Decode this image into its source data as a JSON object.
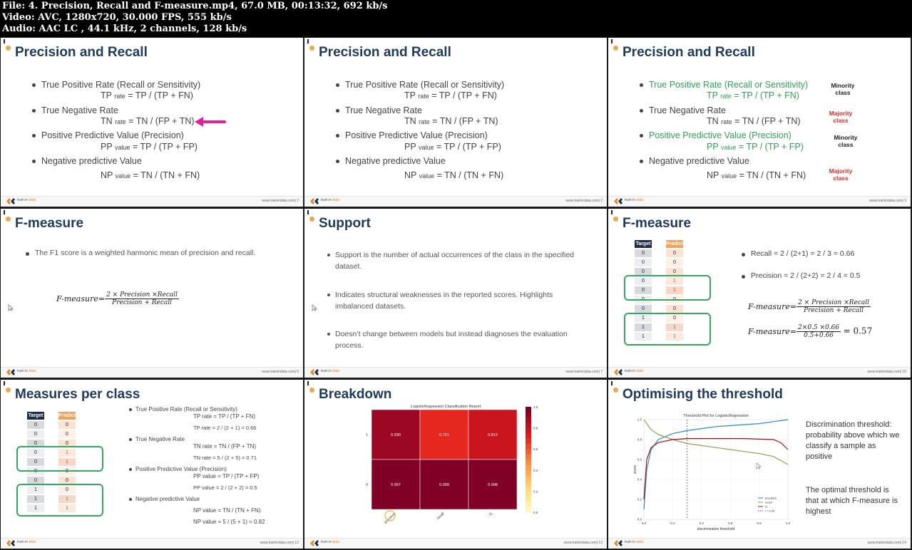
{
  "media_info": {
    "file": "File: 4. Precision, Recall and F-measure.mp4, 67.0 MB, 00:13:32, 692 kb/s",
    "video": "Video: AVC, 1280x720, 30.000 FPS, 555 kb/s",
    "audio": "Audio: AAC LC , 44.1 kHz, 2 channels, 128 kb/s"
  },
  "logo": {
    "brand_a": "train in",
    "brand_b": "data"
  },
  "slides": {
    "s1": {
      "title": "Precision and Recall",
      "b1": "True Positive Rate (Recall or Sensitivity)",
      "f1_pre": "TP",
      "f1_sub": "rate",
      "f1_post": "=   TP /  (TP + FN)",
      "b2": "True Negative Rate",
      "f2_pre": "TN",
      "f2_sub": "rate",
      "f2_post": "=  TN /  (FP + TN)",
      "b3": "Positive Predictive Value (Precision)",
      "f3_pre": "PP",
      "f3_sub": "value",
      "f3_post": "=  TP /  (TP + FP)",
      "b4": "Negative predictive Value",
      "f4_pre": "NP",
      "f4_sub": "value",
      "f4_post": "=  TN /  (TN + FN)",
      "url": "www.trainindata.com| 2"
    },
    "s2": {
      "title": "Precision and Recall",
      "b1": "True Positive Rate (Recall or Sensitivity)",
      "f1_pre": "TP",
      "f1_sub": "rate",
      "f1_post": "=   TP /  (TP + FN)",
      "b2": "True Negative Rate",
      "f2_pre": "TN",
      "f2_sub": "rate",
      "f2_post": "=  TN /  (FP + TN)",
      "b3": "Positive Predictive Value (Precision)",
      "f3_pre": "PP",
      "f3_sub": "value",
      "f3_post": "=  TP /  (TP + FP)",
      "b4": "Negative predictive Value",
      "f4_pre": "NP",
      "f4_sub": "value",
      "f4_post": "=  TN /  (TN + FN)",
      "url": "www.trainindata.com| 2"
    },
    "s3": {
      "title": "Precision and Recall",
      "b1": "True Positive Rate (Recall or Sensitivity)",
      "f1_pre": "TP",
      "f1_sub": "rate",
      "f1_post": "=   TP /  (TP + FN)",
      "b2": "True Negative Rate",
      "f2_pre": "TN",
      "f2_sub": "rate",
      "f2_post": "=  TN /  (FP + TN)",
      "b3": "Positive Predictive Value (Precision)",
      "f3_pre": "PP",
      "f3_sub": "value",
      "f3_post": "=  TP /  (TP + FP)",
      "b4": "Negative predictive Value",
      "f4_pre": "NP",
      "f4_sub": "value",
      "f4_post": "=  TN /  (TN + FN)",
      "side1": "Minority class",
      "side2": "Majority class",
      "side3": "Minority class",
      "side4": "Majority class",
      "url": "www.trainindata.com| 3"
    },
    "s4": {
      "title": "F-measure",
      "b1": "The F1 score is a weighted harmonic mean of precision and recall.",
      "lhs": "F-measure=",
      "num": "2 × Precision ×Recall",
      "den": "Precision + Recall",
      "url": "www.trainindata.com| 5"
    },
    "s5": {
      "title": "Support",
      "b1": "Support is the number of actual occurrences of the class in the specified dataset.",
      "b2": "Indicates structural weaknesses in the reported scores. Highlights imbalanced datasets.",
      "b3": "Doesn’t change between models but instead diagnoses the evaluation process.",
      "url": "www.trainindata.com| 7"
    },
    "s6": {
      "title": "F-measure",
      "head_target": "Target",
      "head_pred": "Prediction",
      "targets": [
        "0",
        "0",
        "0",
        "0",
        "0",
        "0",
        "0",
        "1",
        "1",
        "1"
      ],
      "preds": [
        "0",
        "0",
        "0",
        "1",
        "1",
        "0",
        "0",
        "0",
        "1",
        "1"
      ],
      "recall": "Recall = 2 / (2+1) = 2 / 3 = 0.66",
      "precision": "Precision = 2 / (2+2) = 2 / 4 = 0.5",
      "lhs1": "F-measure=",
      "num1": "2 × Precision ×Recall",
      "den1": "Precision + Recall",
      "lhs2": "F-measure=",
      "num2": "2×0.5 ×0.66",
      "den2": "0.5+0.66",
      "result": "= 0.57",
      "url": "www.trainindata.com| 10"
    },
    "s7": {
      "title": "Measures per class",
      "head_target": "Target",
      "head_pred": "Prediction",
      "targets": [
        "0",
        "0",
        "0",
        "0",
        "0",
        "0",
        "0",
        "1",
        "1",
        "1"
      ],
      "preds": [
        "0",
        "0",
        "0",
        "1",
        "1",
        "0",
        "0",
        "0",
        "1",
        "1"
      ],
      "b1": "True Positive Rate (Recall or Sensitivity)",
      "f1a": "TP rate =   TP /  (TP + FN)",
      "f1b": "TP rate  = 2 / (2 + 1) = 0.66",
      "b2": "True Negative Rate",
      "f2a": "TN rate =  TN /  (FP + TN)",
      "f2b": "TN rate = 5 / (2 + 5) = 0.71",
      "b3": "Positive Predictive Value (Precision)",
      "f3a": "PP value =  TP /  (TP + FP)",
      "f3b": "PP value = 2 / (2 + 2) = 0.5",
      "b4": "Negative predictive Value",
      "f4a": "NP value =  TN /  (TN + FN)",
      "f4b": "NP value = 5 / (5 + 1) = 0.82",
      "url": "www.trainindata.com| 12"
    },
    "s8": {
      "title": "Breakdown",
      "chart_title": "LogisticRegression Classification Report",
      "url": "www.trainindata.com| 13"
    },
    "s9": {
      "title": "Optimising the threshold",
      "chart_title": "Threshold Plot for LogisticRegression",
      "p1": "Discrimination threshold: probability above which we classify a sample as positive",
      "p2": "The optimal threshold is that at which F-measure is highest",
      "xlabel": "discrimination threshold",
      "ylabel": "score",
      "url": "www.trainindata.com| 14"
    }
  },
  "chart_data": [
    {
      "type": "heatmap",
      "title": "LogisticRegression Classification Report",
      "x_labels": [
        "precision",
        "recall",
        "f1"
      ],
      "y_labels": [
        "1",
        "0"
      ],
      "values": [
        [
          0.93,
          0.721,
          0.812
        ],
        [
          0.997,
          0.999,
          0.998
        ]
      ],
      "colorbar_range": [
        0.0,
        1.0
      ],
      "colorbar_ticks": [
        "1.0",
        "0.8",
        "0.6",
        "0.4",
        "0.2",
        "0.0"
      ]
    },
    {
      "type": "line",
      "title": "Threshold Plot for LogisticRegression",
      "xlabel": "discrimination threshold",
      "ylabel": "score",
      "x_ticks": [
        "0.0",
        "0.2",
        "0.4",
        "0.6",
        "0.8",
        "1.0"
      ],
      "y_ticks": [
        "1.0",
        "0.8",
        "0.6",
        "0.4",
        "0.2",
        "0.0"
      ],
      "xlim": [
        0,
        1
      ],
      "ylim": [
        0,
        1
      ],
      "legend": [
        "precision",
        "recall",
        "f1",
        "t = 0.30"
      ],
      "legend_position": "lower-right",
      "threshold": 0.3,
      "series": [
        {
          "name": "precision",
          "color": "#2b8cbe",
          "x": [
            0.0,
            0.02,
            0.05,
            0.1,
            0.2,
            0.3,
            0.4,
            0.5,
            0.6,
            0.7,
            0.8,
            0.9,
            1.0
          ],
          "y": [
            0.1,
            0.5,
            0.7,
            0.8,
            0.86,
            0.89,
            0.91,
            0.93,
            0.94,
            0.95,
            0.96,
            0.98,
            1.0
          ]
        },
        {
          "name": "recall",
          "color": "#8ca252",
          "x": [
            0.0,
            0.05,
            0.1,
            0.2,
            0.3,
            0.4,
            0.5,
            0.6,
            0.7,
            0.8,
            0.9,
            1.0
          ],
          "y": [
            1.0,
            0.9,
            0.85,
            0.8,
            0.76,
            0.74,
            0.72,
            0.7,
            0.68,
            0.66,
            0.63,
            0.55
          ]
        },
        {
          "name": "f1",
          "color": "#a50f15",
          "x": [
            0.0,
            0.02,
            0.05,
            0.1,
            0.2,
            0.3,
            0.5,
            0.7,
            0.9,
            0.95,
            1.0
          ],
          "y": [
            0.2,
            0.6,
            0.72,
            0.77,
            0.8,
            0.81,
            0.81,
            0.81,
            0.8,
            0.77,
            0.7
          ]
        }
      ]
    }
  ]
}
